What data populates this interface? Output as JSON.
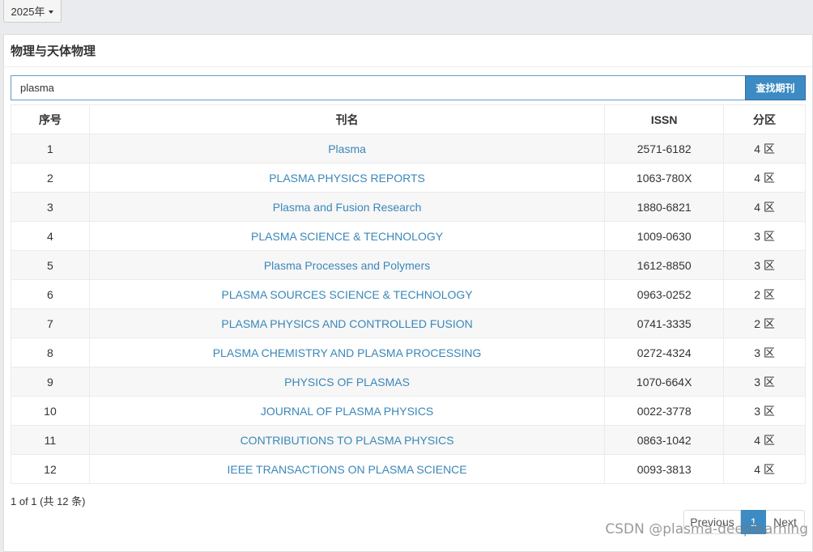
{
  "year_dropdown": {
    "label": "2025年"
  },
  "panel": {
    "title": "物理与天体物理"
  },
  "search": {
    "value": "plasma",
    "button_label": "查找期刊"
  },
  "table": {
    "headers": {
      "index": "序号",
      "name": "刊名",
      "issn": "ISSN",
      "zone": "分区"
    },
    "rows": [
      {
        "index": "1",
        "name": "Plasma",
        "issn": "2571-6182",
        "zone": "4 区"
      },
      {
        "index": "2",
        "name": "PLASMA PHYSICS REPORTS",
        "issn": "1063-780X",
        "zone": "4 区"
      },
      {
        "index": "3",
        "name": "Plasma and Fusion Research",
        "issn": "1880-6821",
        "zone": "4 区"
      },
      {
        "index": "4",
        "name": "PLASMA SCIENCE & TECHNOLOGY",
        "issn": "1009-0630",
        "zone": "3 区"
      },
      {
        "index": "5",
        "name": "Plasma Processes and Polymers",
        "issn": "1612-8850",
        "zone": "3 区"
      },
      {
        "index": "6",
        "name": "PLASMA SOURCES SCIENCE & TECHNOLOGY",
        "issn": "0963-0252",
        "zone": "2 区"
      },
      {
        "index": "7",
        "name": "PLASMA PHYSICS AND CONTROLLED FUSION",
        "issn": "0741-3335",
        "zone": "2 区"
      },
      {
        "index": "8",
        "name": "PLASMA CHEMISTRY AND PLASMA PROCESSING",
        "issn": "0272-4324",
        "zone": "3 区"
      },
      {
        "index": "9",
        "name": "PHYSICS OF PLASMAS",
        "issn": "1070-664X",
        "zone": "3 区"
      },
      {
        "index": "10",
        "name": "JOURNAL OF PLASMA PHYSICS",
        "issn": "0022-3778",
        "zone": "3 区"
      },
      {
        "index": "11",
        "name": "CONTRIBUTIONS TO PLASMA PHYSICS",
        "issn": "0863-1042",
        "zone": "4 区"
      },
      {
        "index": "12",
        "name": "IEEE TRANSACTIONS ON PLASMA SCIENCE",
        "issn": "0093-3813",
        "zone": "4 区"
      }
    ]
  },
  "pagination": {
    "info": "1 of 1 (共 12 条)",
    "previous_label": "Previous",
    "current_page": "1",
    "next_label": "Next"
  },
  "watermark": {
    "text": "CSDN @plasma-deeplearning"
  },
  "colors": {
    "accent": "#3d8bc2",
    "link": "#3a87b8",
    "page_bg": "#e9ebee"
  }
}
